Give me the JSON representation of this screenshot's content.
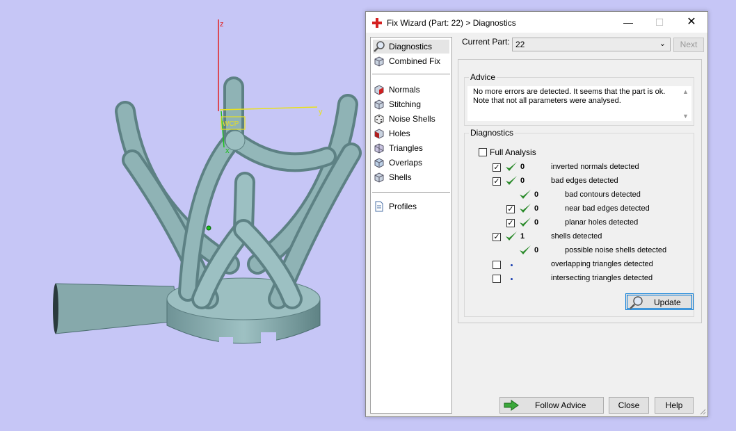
{
  "viewport": {
    "axis_labels": {
      "z": "z",
      "y": "y",
      "x": "x"
    },
    "wcp_label": "WCP",
    "background_color": "#c6c6f6",
    "model_color": "#86a9ab"
  },
  "dialog": {
    "title": "Fix Wizard (Part: 22) > Diagnostics",
    "icons": {
      "title": "red-cross-icon",
      "minimize": "minimize-icon",
      "maximize": "maximize-icon",
      "close": "close-icon"
    },
    "sidebar": {
      "groups": [
        [
          {
            "label": "Diagnostics",
            "icon": "magnifier-icon",
            "selected": true
          },
          {
            "label": "Combined Fix",
            "icon": "cube-icon"
          }
        ],
        [
          {
            "label": "Normals",
            "icon": "normals-cube-icon"
          },
          {
            "label": "Stitching",
            "icon": "stitching-cube-icon"
          },
          {
            "label": "Noise Shells",
            "icon": "noise-shells-dice-icon"
          },
          {
            "label": "Holes",
            "icon": "holes-cube-icon"
          },
          {
            "label": "Triangles",
            "icon": "triangles-cube-icon"
          },
          {
            "label": "Overlaps",
            "icon": "overlaps-cube-icon"
          },
          {
            "label": "Shells",
            "icon": "shells-cube-icon"
          }
        ],
        [
          {
            "label": "Profiles",
            "icon": "document-icon"
          }
        ]
      ]
    },
    "current_part": {
      "label": "Current Part:",
      "value": "22"
    },
    "next_label": "Next",
    "advice": {
      "title": "Advice",
      "lines": [
        "No more errors are detected. It seems that the part is ok.",
        "Note that not all parameters were analysed."
      ]
    },
    "diagnostics": {
      "title": "Diagnostics",
      "full_analysis": {
        "label": "Full Analysis",
        "checked": false
      },
      "rows": [
        {
          "checked": true,
          "status": "ok",
          "count": "0",
          "label": "inverted normals detected",
          "indent": 0
        },
        {
          "checked": true,
          "status": "ok",
          "count": "0",
          "label": "bad edges detected",
          "indent": 0
        },
        {
          "checked": null,
          "status": "ok",
          "count": "0",
          "label": "bad contours detected",
          "indent": 1
        },
        {
          "checked": true,
          "status": "ok",
          "count": "0",
          "label": "near bad edges detected",
          "indent": 1
        },
        {
          "checked": true,
          "status": "ok",
          "count": "0",
          "label": "planar holes detected",
          "indent": 1
        },
        {
          "checked": true,
          "status": "ok",
          "count": "1",
          "label": "shells detected",
          "indent": 0
        },
        {
          "checked": null,
          "status": "ok",
          "count": "0",
          "label": "possible noise shells detected",
          "indent": 1
        },
        {
          "checked": false,
          "status": "unknown",
          "count": "",
          "label": "overlapping triangles detected",
          "indent": 0
        },
        {
          "checked": false,
          "status": "unknown",
          "count": "",
          "label": "intersecting triangles detected",
          "indent": 0
        }
      ],
      "update_label": "Update",
      "update_icon": "magnifier-icon"
    },
    "buttons": {
      "follow_advice": "Follow Advice",
      "follow_advice_icon": "green-arrow-right-icon",
      "close": "Close",
      "help": "Help"
    },
    "colors": {
      "check_green": "#2a8a2a",
      "title_red": "#d42020"
    }
  }
}
